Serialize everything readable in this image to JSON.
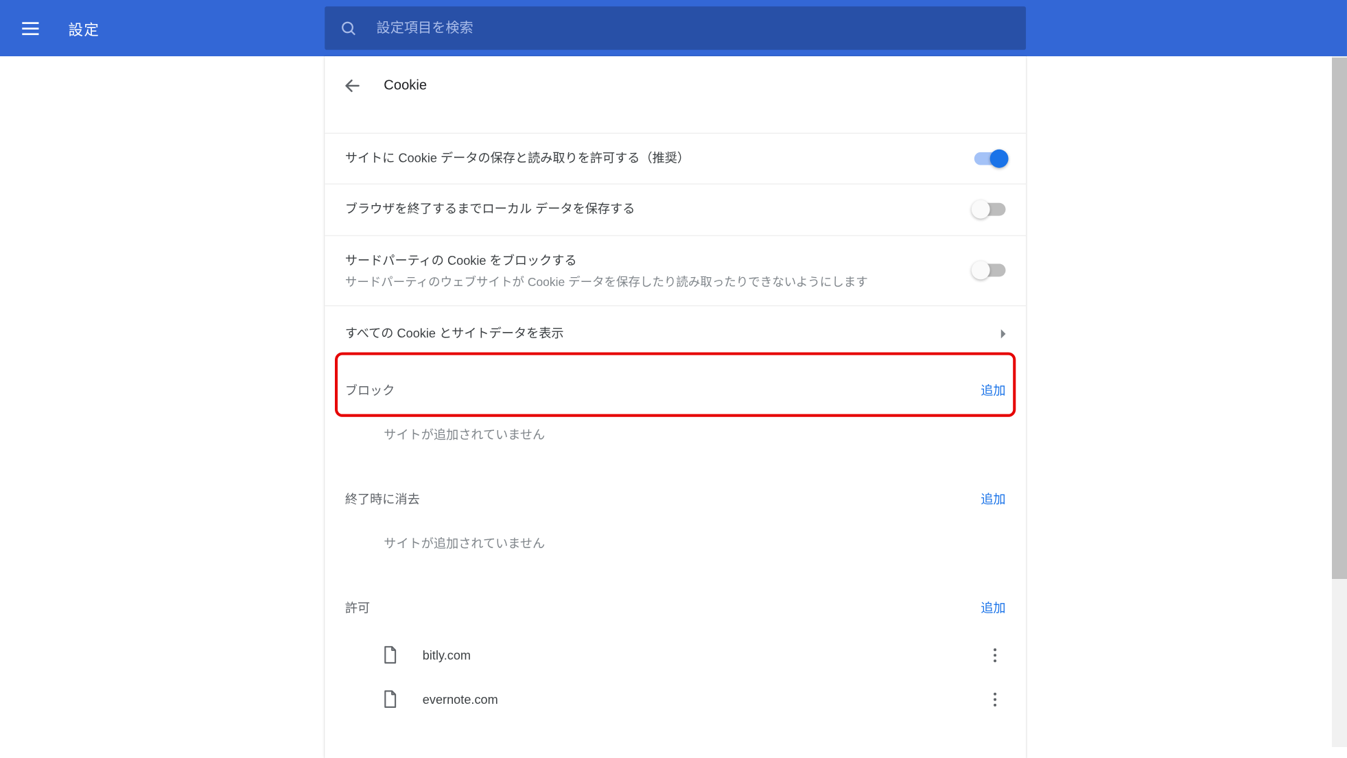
{
  "header": {
    "title": "設定",
    "search_placeholder": "設定項目を検索"
  },
  "page": {
    "title": "Cookie"
  },
  "settings": [
    {
      "label": "サイトに Cookie データの保存と読み取りを許可する（推奨）",
      "sub": "",
      "state": "on"
    },
    {
      "label": "ブラウザを終了するまでローカル データを保存する",
      "sub": "",
      "state": "off"
    },
    {
      "label": "サードパーティの Cookie をブロックする",
      "sub": "サードパーティのウェブサイトが Cookie データを保存したり読み取ったりできないようにします",
      "state": "off"
    }
  ],
  "link_row": {
    "label": "すべての Cookie とサイトデータを表示"
  },
  "sections": {
    "block": {
      "title": "ブロック",
      "add": "追加",
      "empty": "サイトが追加されていません"
    },
    "clear": {
      "title": "終了時に消去",
      "add": "追加",
      "empty": "サイトが追加されていません"
    },
    "allow": {
      "title": "許可",
      "add": "追加",
      "items": [
        {
          "label": "bitly.com"
        },
        {
          "label": "evernote.com"
        }
      ]
    }
  }
}
